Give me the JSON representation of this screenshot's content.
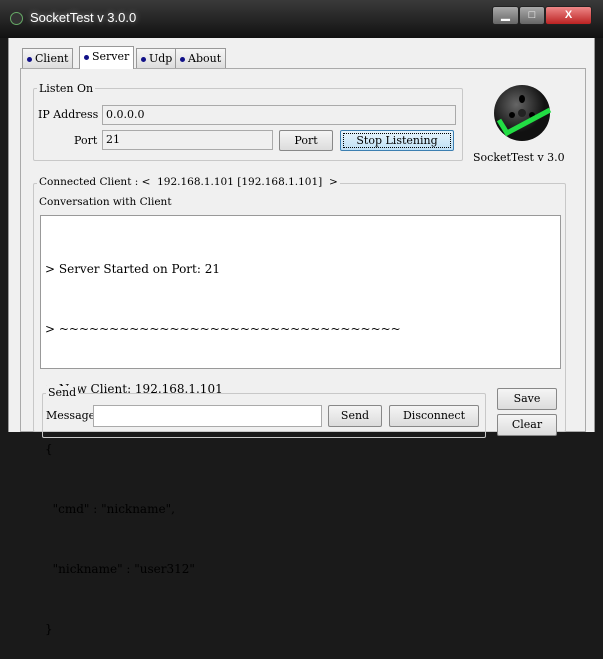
{
  "window": {
    "title": "SocketTest v 3.0.0",
    "minimize": "▁",
    "maximize": "□",
    "close": "X"
  },
  "tabs": [
    {
      "label": "Client"
    },
    {
      "label": "Server",
      "active": true
    },
    {
      "label": "Udp"
    },
    {
      "label": "About"
    }
  ],
  "listen": {
    "legend": "Listen On",
    "ip_label": "IP Address",
    "ip_value": "0.0.0.0",
    "port_label": "Port",
    "port_value": "21",
    "port_button": "Port",
    "stop_button": "Stop Listening"
  },
  "logo": {
    "caption": "SocketTest v 3.0",
    "check_color": "#22dd44"
  },
  "connected": {
    "legend": "Connected Client : <  192.168.1.101 [192.168.1.101]  >",
    "conv_label": "Conversation with Client",
    "lines": [
      "> Server Started on Port: 21",
      "> ~~~~~~~~~~~~~~~~~~~~~~~~~~~~~~~~~~",
      "> New Client: 192.168.1.101",
      "{",
      "  \"cmd\" : \"nickname\",",
      "  \"nickname\" : \"user312\"",
      "}"
    ]
  },
  "send": {
    "legend": "Send",
    "message_label": "Message",
    "message_value": "",
    "send_button": "Send",
    "disconnect_button": "Disconnect"
  },
  "side": {
    "save_button": "Save",
    "clear_button": "Clear"
  }
}
